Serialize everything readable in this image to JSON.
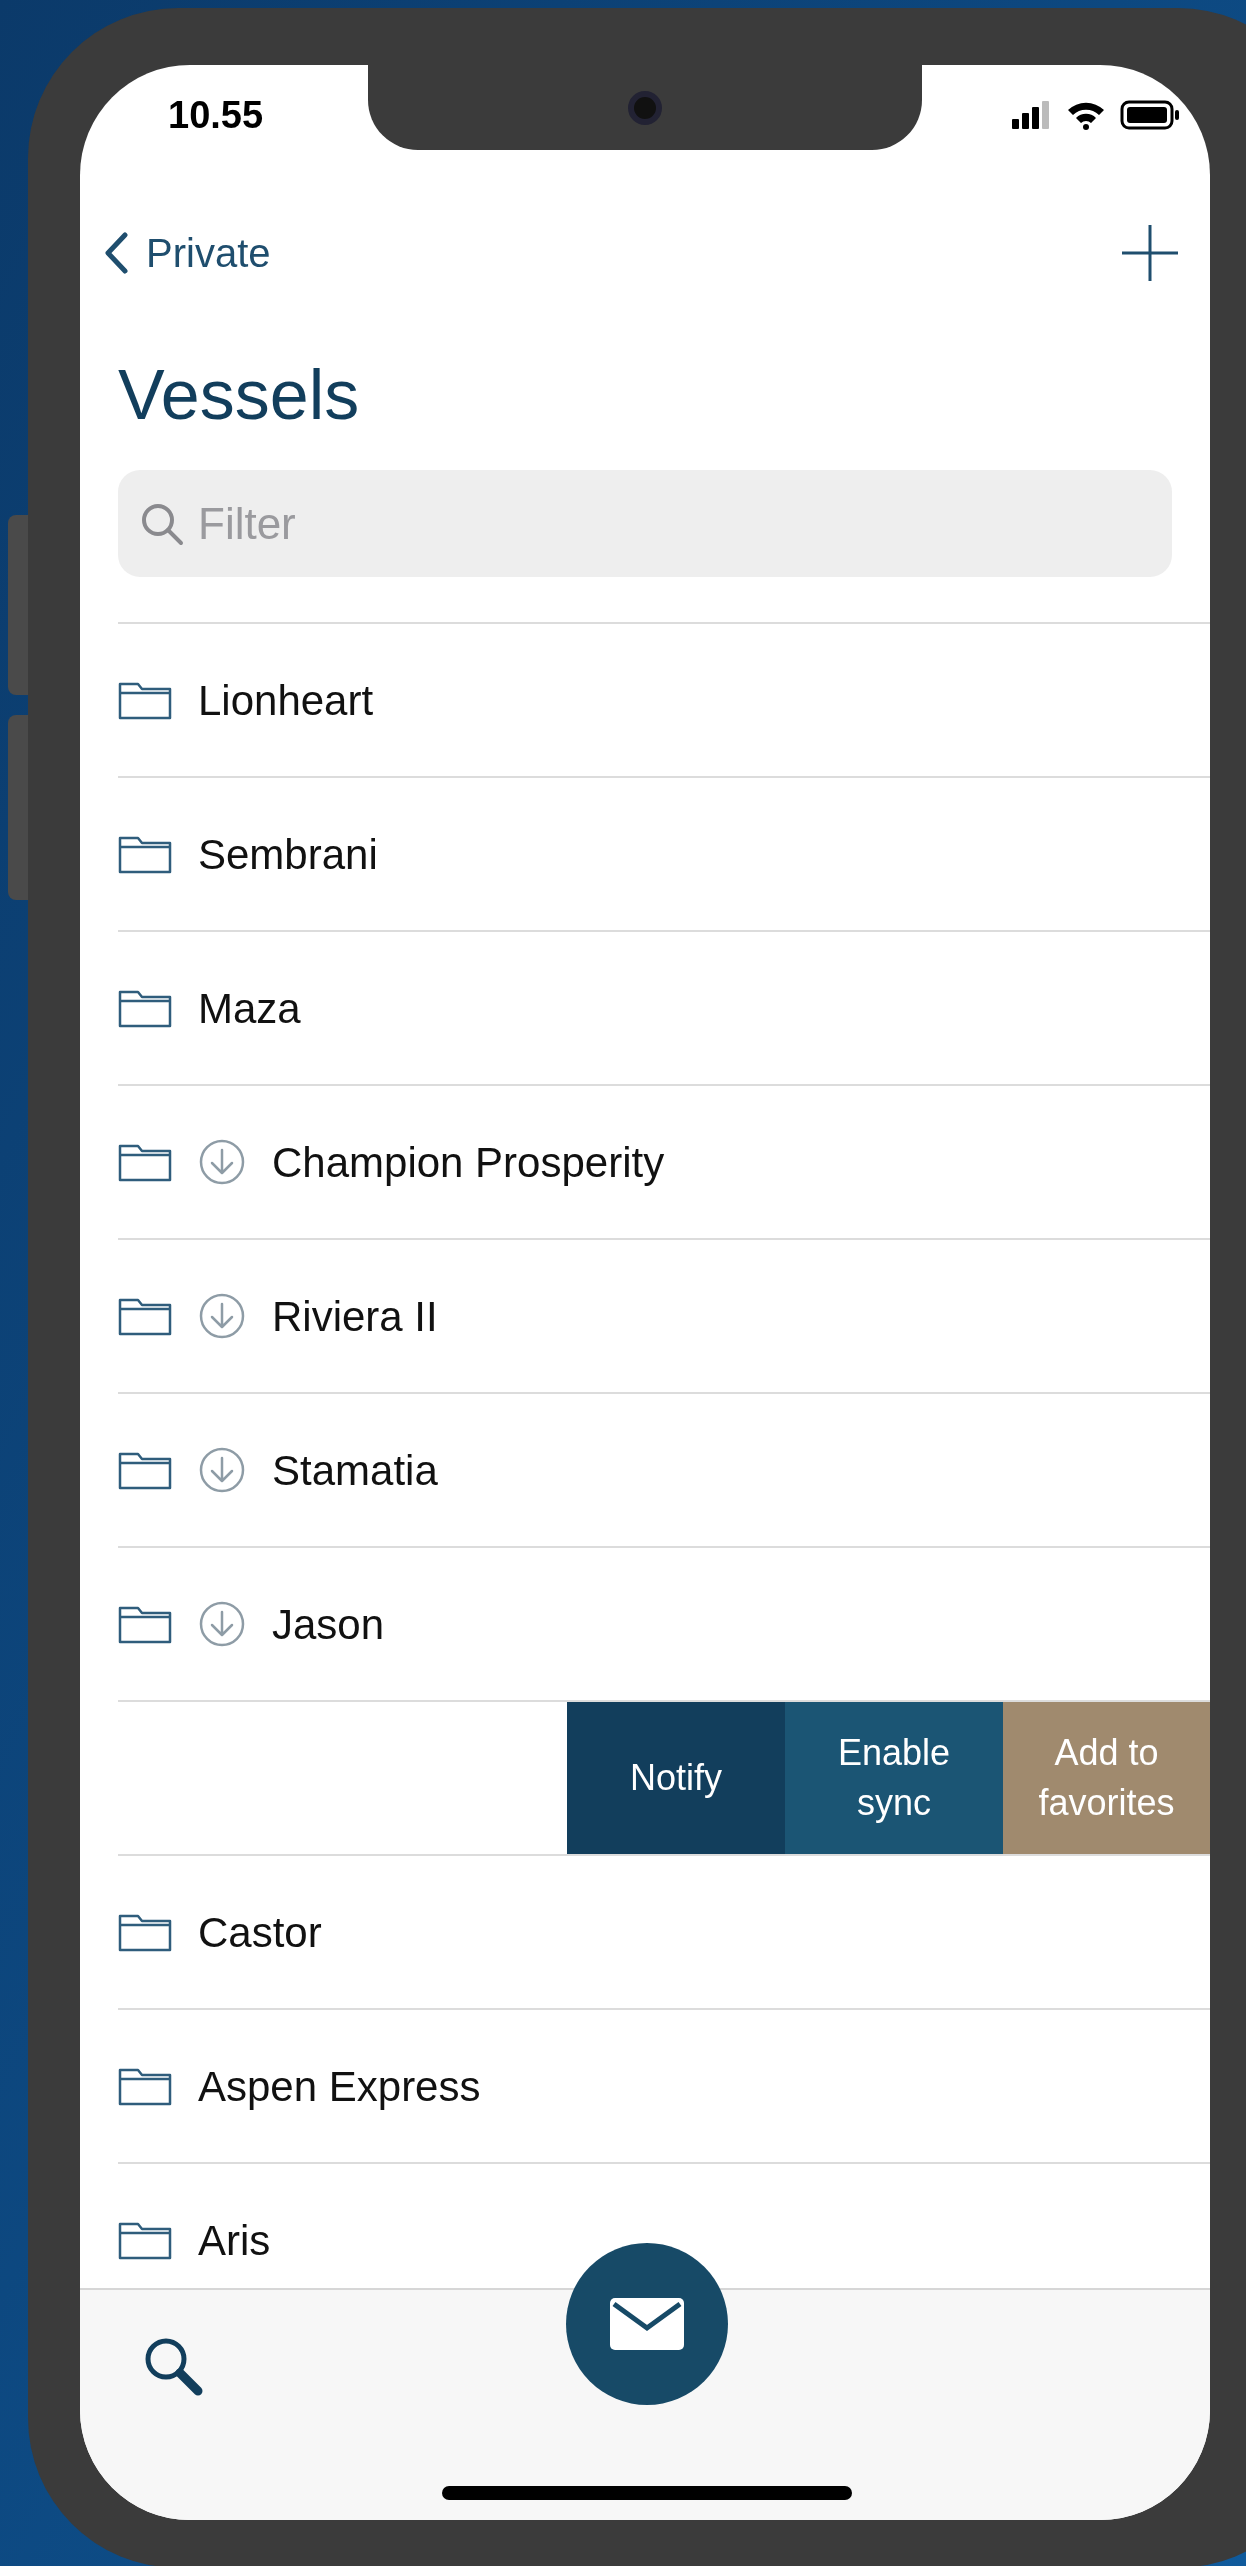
{
  "status_bar": {
    "time": "10.55"
  },
  "nav": {
    "back_label": "Private"
  },
  "title": "Vessels",
  "filter": {
    "placeholder": "Filter"
  },
  "rows": [
    {
      "kind": "folder",
      "name": "Lionheart",
      "downloaded": false
    },
    {
      "kind": "folder",
      "name": "Sembrani",
      "downloaded": false
    },
    {
      "kind": "folder",
      "name": "Maza",
      "downloaded": false
    },
    {
      "kind": "folder",
      "name": "Champion Prosperity",
      "downloaded": true
    },
    {
      "kind": "folder",
      "name": "Riviera II",
      "downloaded": true
    },
    {
      "kind": "folder",
      "name": "Stamatia",
      "downloaded": true
    },
    {
      "kind": "folder",
      "name": "Jason",
      "downloaded": true
    },
    {
      "kind": "swiped",
      "actions": [
        {
          "label": "Notify",
          "color": "#123e5c"
        },
        {
          "label": "Enable sync",
          "color": "#1b5574"
        },
        {
          "label": "Add to favorites",
          "color": "#a08a6e"
        }
      ]
    },
    {
      "kind": "folder",
      "name": "Castor",
      "downloaded": false
    },
    {
      "kind": "folder",
      "name": "Aspen Express",
      "downloaded": false
    },
    {
      "kind": "folder",
      "name": "Aris",
      "downloaded": false
    }
  ]
}
